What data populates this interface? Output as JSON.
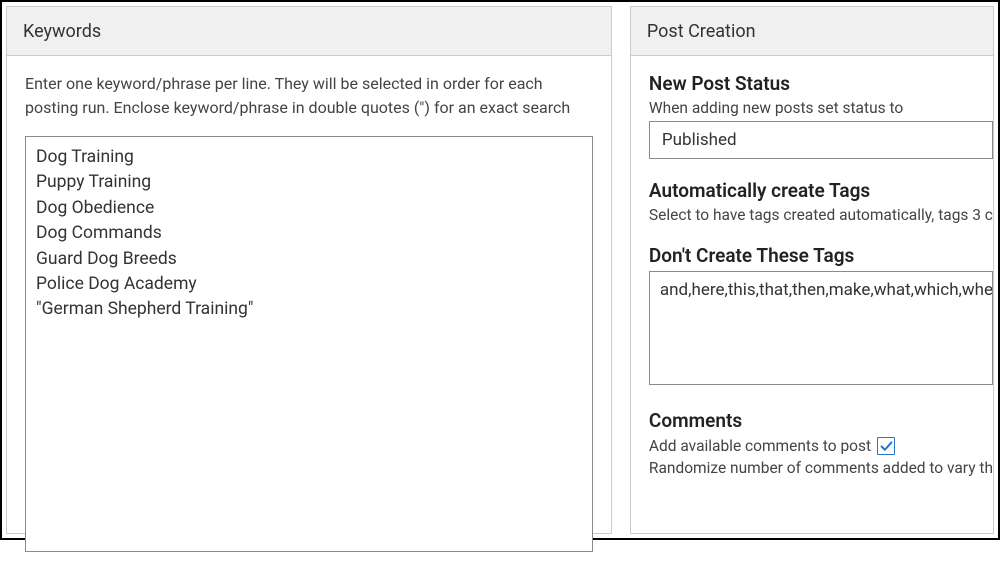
{
  "keywords_panel": {
    "title": "Keywords",
    "help": "Enter one keyword/phrase per line. They will be selected in order for each posting run. Enclose keyword/phrase in double quotes (\") for an exact search",
    "textarea_value": "Dog Training\nPuppy Training\nDog Obedience\nDog Commands\nGuard Dog Breeds\nPolice Dog Academy\n\"German Shepherd Training\""
  },
  "post_creation_panel": {
    "title": "Post Creation",
    "status_section": {
      "heading": "New Post Status",
      "label": "When adding new posts set status to",
      "value": "Published"
    },
    "tags_section": {
      "heading": "Automatically create Tags",
      "label": "Select to have tags created automatically, tags 3 c"
    },
    "exclude_tags_section": {
      "heading": "Don't Create These Tags",
      "value": "and,here,this,that,then,make,what,which,when"
    },
    "comments_section": {
      "heading": "Comments",
      "add_label": "Add available comments to post",
      "add_checked": true,
      "randomize_label": "Randomize number of comments added to vary th"
    }
  }
}
